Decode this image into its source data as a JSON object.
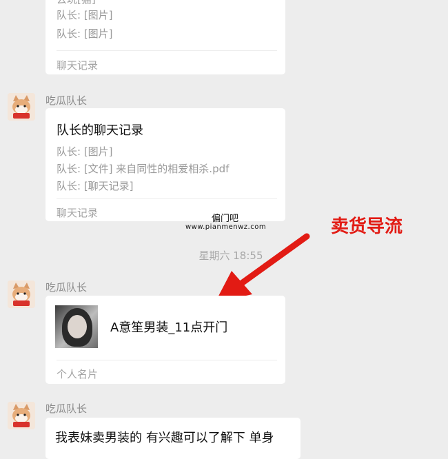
{
  "chat": {
    "top_card": {
      "partial_line": "去玩[猫]",
      "lines": [
        "队长: [图片]",
        "队长: [图片]"
      ],
      "footer": "聊天记录"
    },
    "message_1": {
      "sender": "吃瓜队长",
      "card_title": "队长的聊天记录",
      "lines": [
        "队长: [图片]",
        "队长: [文件] 来自同性的相爱相杀.pdf",
        "队长: [聊天记录]"
      ],
      "footer": "聊天记录"
    },
    "timestamp": "星期六 18:55",
    "message_2": {
      "sender": "吃瓜队长",
      "card_title": "A意笙男装_11点开门",
      "footer": "个人名片"
    },
    "message_3": {
      "sender": "吃瓜队长",
      "text": "我表妹卖男装的 有兴趣可以了解下 单身"
    }
  },
  "watermark": {
    "cn": "偏门吧",
    "url": "www.pianmenwz.com"
  },
  "annotation": {
    "label": "卖货导流",
    "color": "#e21b14"
  }
}
